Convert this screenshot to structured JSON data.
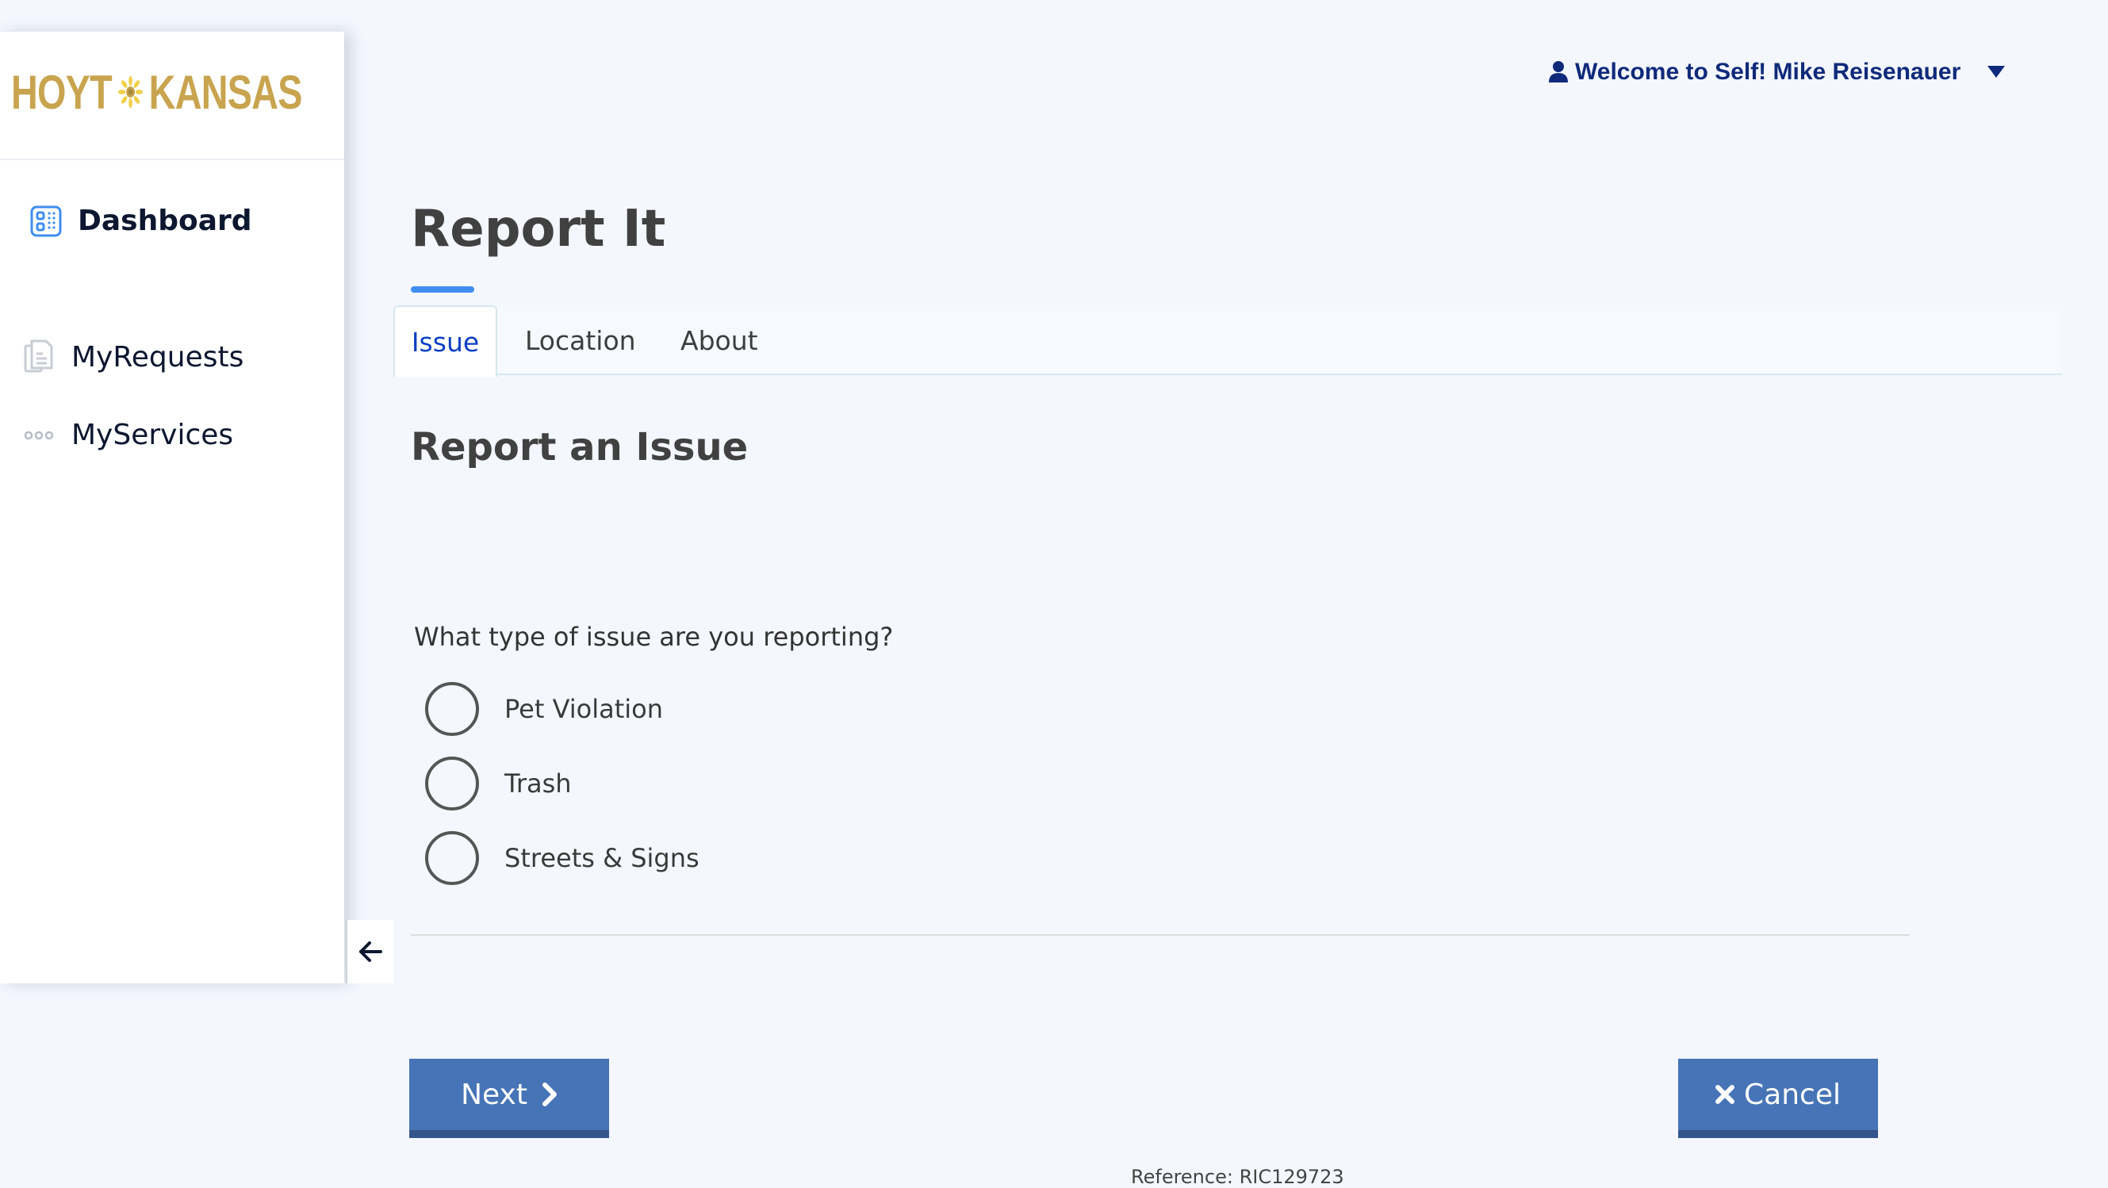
{
  "brand": {
    "logo_left": "HOYT",
    "logo_right": "KANSAS",
    "logo_color": "#c9a44f"
  },
  "sidebar": {
    "items": [
      {
        "label": "Dashboard",
        "icon": "dashboard-icon",
        "active": true
      },
      {
        "label": "MyRequests",
        "icon": "documents-icon",
        "active": false
      },
      {
        "label": "MyServices",
        "icon": "more-dots-icon",
        "active": false
      }
    ],
    "collapse_icon": "arrow-left-icon"
  },
  "header": {
    "user_icon": "user-icon",
    "welcome_text": "Welcome to Self! Mike Reisenauer",
    "dropdown_icon": "caret-down-icon"
  },
  "page": {
    "title": "Report It",
    "tabs": [
      {
        "label": "Issue",
        "active": true
      },
      {
        "label": "Location",
        "active": false
      },
      {
        "label": "About",
        "active": false
      }
    ],
    "section_title": "Report an Issue",
    "question": "What type of issue are you reporting?",
    "options": [
      {
        "label": "Pet Violation",
        "selected": false
      },
      {
        "label": "Trash",
        "selected": false
      },
      {
        "label": "Streets & Signs",
        "selected": false
      }
    ]
  },
  "actions": {
    "next_label": "Next",
    "next_icon": "chevron-right-icon",
    "cancel_label": "Cancel",
    "cancel_icon": "close-icon"
  },
  "footer": {
    "reference": "Reference: RIC129723"
  },
  "colors": {
    "accent": "#3f8ef0",
    "button": "#4674b6",
    "button_border": "#34568c",
    "active_tab_text": "#0b3fc2",
    "user_text": "#0f2a7a"
  }
}
